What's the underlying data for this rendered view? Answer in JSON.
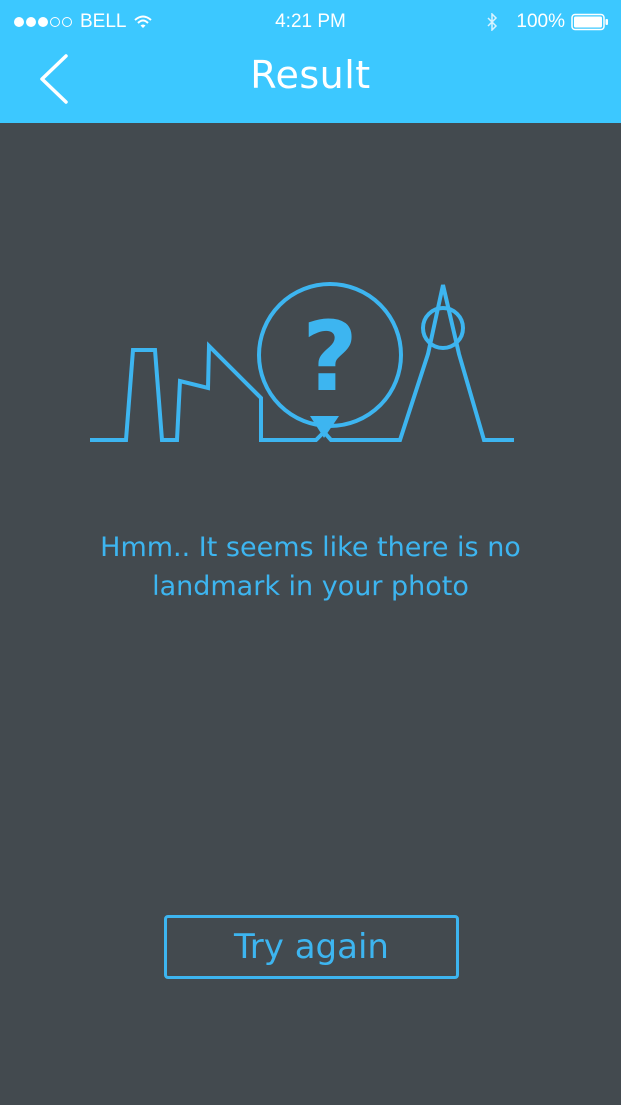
{
  "status_bar": {
    "carrier": "BELL",
    "time": "4:21 PM",
    "battery": "100%",
    "signal_bars_filled": 3,
    "signal_bars_total": 5
  },
  "header": {
    "title": "Result",
    "back_icon": "chevron-left-icon"
  },
  "main": {
    "illustration_icon": "skyline-question-icon",
    "message": "Hmm.. It seems like there is no landmark in your photo"
  },
  "actions": {
    "try_again_label": "Try again"
  },
  "colors": {
    "header_bg": "#3cc8ff",
    "page_bg": "#434a4f",
    "accent": "#3db5f0"
  }
}
